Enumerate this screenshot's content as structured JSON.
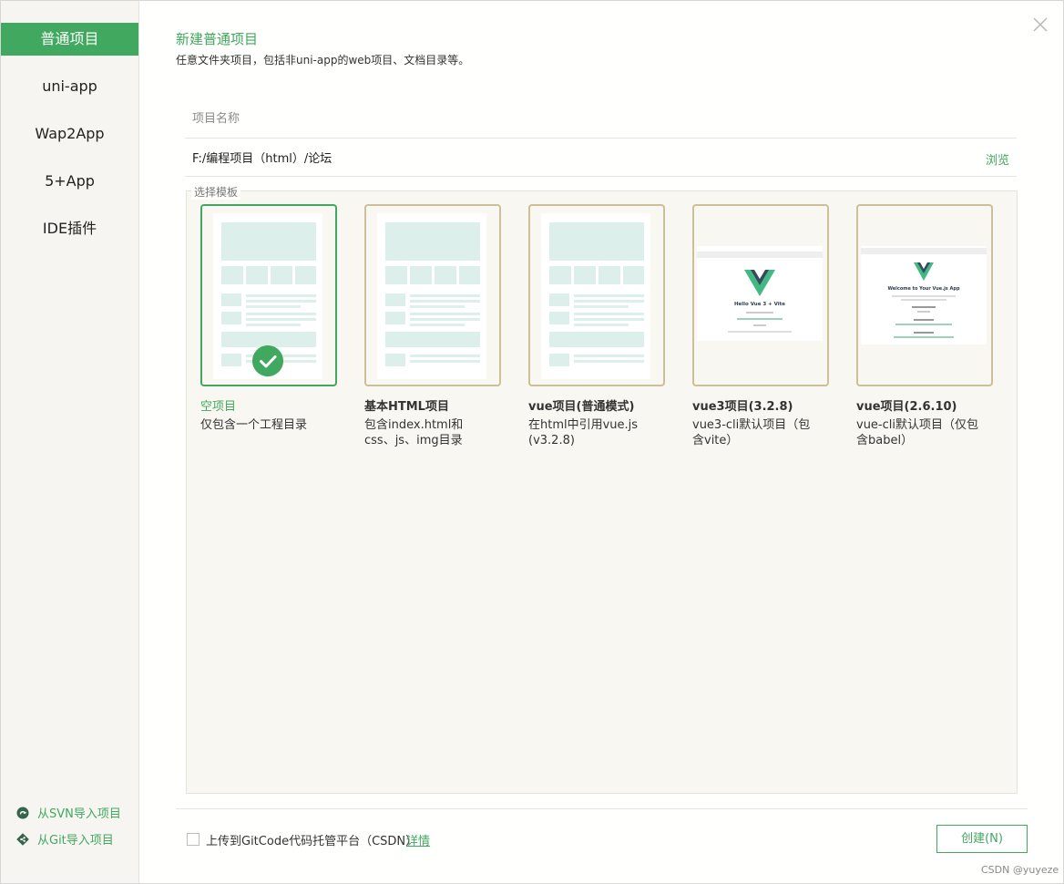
{
  "sidebar": {
    "items": [
      {
        "label": "普通项目",
        "active": true
      },
      {
        "label": "uni-app"
      },
      {
        "label": "Wap2App"
      },
      {
        "label": "5+App"
      },
      {
        "label": "IDE插件"
      }
    ],
    "import_svn": "从SVN导入项目",
    "import_git": "从Git导入项目"
  },
  "header": {
    "title": "新建普通项目",
    "subtitle": "任意文件夹项目，包括非uni-app的web项目、文档目录等。"
  },
  "form": {
    "name_placeholder": "项目名称",
    "name_value": "",
    "path_value": "F:/编程项目（html）/论坛",
    "browse_label": "浏览"
  },
  "templates": {
    "legend": "选择模板",
    "items": [
      {
        "name": "空项目",
        "desc": "仅包含一个工程目录",
        "selected": true
      },
      {
        "name": "基本HTML项目",
        "desc": "包含index.html和css、js、img目录"
      },
      {
        "name": "vue项目(普通模式)",
        "desc": "在html中引用vue.js (v3.2.8)"
      },
      {
        "name": "vue3项目(3.2.8)",
        "desc": "vue3-cli默认项目（包含vite）",
        "thumb_title": "Hello Vue 3 + Vite"
      },
      {
        "name": "vue项目(2.6.10)",
        "desc": "vue-cli默认项目（仅包含babel）",
        "thumb_title": "Welcome to Your Vue.js App"
      }
    ]
  },
  "footer": {
    "upload_label": "上传到GitCode代码托管平台（CSDN）",
    "upload_checked": false,
    "details_label": "详情",
    "create_label": "创建(N)"
  },
  "watermark": "CSDN @yuyeze",
  "colors": {
    "accent": "#41a85f",
    "thumb_border": "#cdbf98",
    "panel_bg": "#f8f7f1",
    "wireframe": "#dcefeb",
    "vue_green": "#42b883",
    "vue_dark": "#35495e"
  }
}
